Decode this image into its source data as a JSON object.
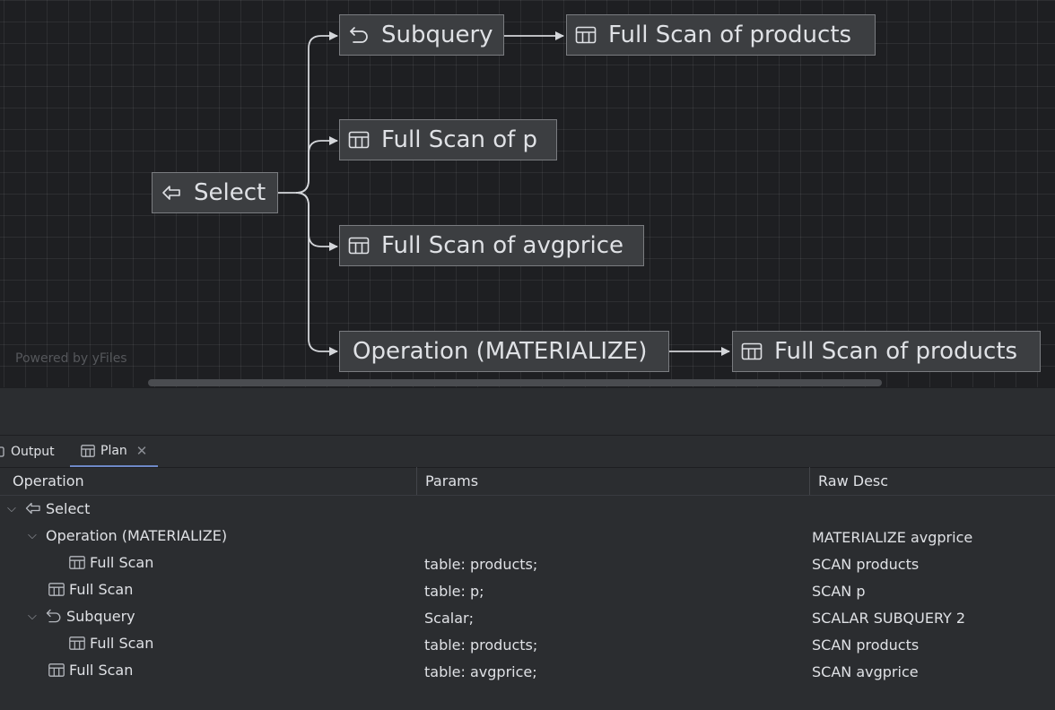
{
  "diagram": {
    "nodes": {
      "select": {
        "label": "Select",
        "icon": "arrow-left-icon"
      },
      "subquery": {
        "label": "Subquery",
        "icon": "undo-arrow-icon"
      },
      "scan_products_top": {
        "label": "Full Scan of products",
        "icon": "table-icon"
      },
      "scan_p": {
        "label": "Full Scan of p",
        "icon": "table-icon"
      },
      "scan_avgprice": {
        "label": "Full Scan of avgprice",
        "icon": "table-icon"
      },
      "materialize": {
        "label": "Operation (MATERIALIZE)"
      },
      "scan_products_bottom": {
        "label": "Full Scan of products",
        "icon": "table-icon"
      }
    },
    "watermark": "Powered by yFiles"
  },
  "tabs": {
    "output": "Output",
    "plan": "Plan"
  },
  "plan_table": {
    "columns": [
      "Operation",
      "Params",
      "Raw Desc"
    ],
    "rows": [
      {
        "operation": "Select",
        "params": "",
        "raw": ""
      },
      {
        "operation": "Operation (MATERIALIZE)",
        "params": "",
        "raw": "MATERIALIZE avgprice"
      },
      {
        "operation": "Full Scan",
        "params": "table: products;",
        "raw": "SCAN products"
      },
      {
        "operation": "Full Scan",
        "params": "table: p;",
        "raw": "SCAN p"
      },
      {
        "operation": "Subquery",
        "params": "Scalar;",
        "raw": "SCALAR SUBQUERY 2"
      },
      {
        "operation": "Full Scan",
        "params": "table: products;",
        "raw": "SCAN products"
      },
      {
        "operation": "Full Scan",
        "params": "table: avgprice;",
        "raw": "SCAN avgprice"
      }
    ]
  }
}
